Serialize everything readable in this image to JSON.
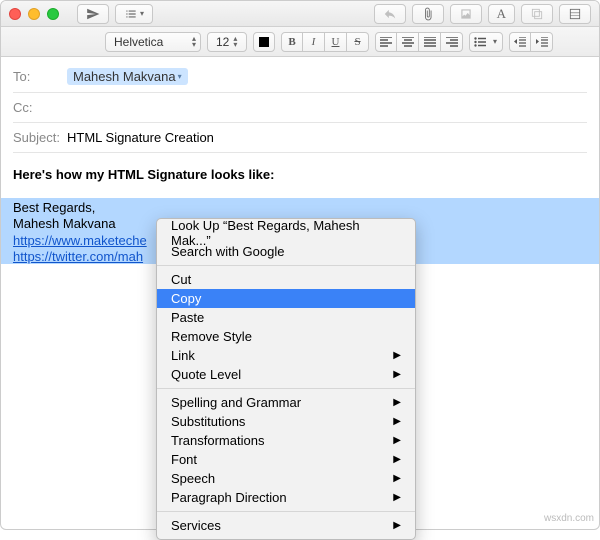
{
  "toolbar": {
    "font_family": "Helvetica",
    "font_size": "12"
  },
  "fields": {
    "to_label": "To:",
    "to_value": "Mahesh Makvana",
    "cc_label": "Cc:",
    "subject_label": "Subject:",
    "subject_value": "HTML Signature Creation"
  },
  "body": {
    "intro": "Here's how my HTML Signature looks like:",
    "sig_line1": "Best Regards,",
    "sig_line2": "Mahesh Makvana",
    "sig_link1": "https://www.maketeche",
    "sig_link2": "https://twitter.com/mah"
  },
  "menu": {
    "lookup": "Look Up “Best Regards, Mahesh Mak...”",
    "search": "Search with Google",
    "cut": "Cut",
    "copy": "Copy",
    "paste": "Paste",
    "remove_style": "Remove Style",
    "link": "Link",
    "quote_level": "Quote Level",
    "spelling": "Spelling and Grammar",
    "substitutions": "Substitutions",
    "transformations": "Transformations",
    "font": "Font",
    "speech": "Speech",
    "paragraph_direction": "Paragraph Direction",
    "services": "Services"
  },
  "watermark": "wsxdn.com"
}
